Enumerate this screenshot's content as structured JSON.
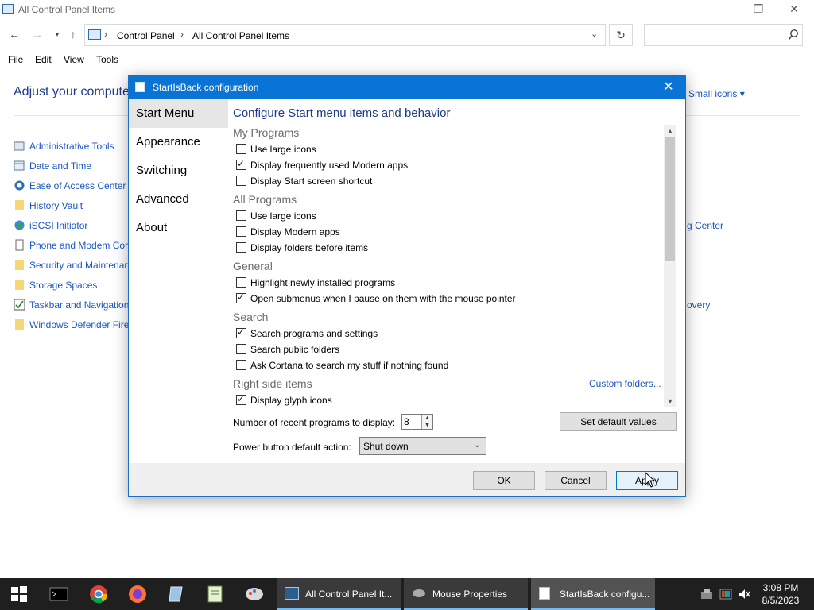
{
  "explorer": {
    "title": "All Control Panel Items",
    "breadcrumbs": [
      "Control Panel",
      "All Control Panel Items"
    ],
    "search_placeholder": "",
    "menu": [
      "File",
      "Edit",
      "View",
      "Tools"
    ],
    "heading": "Adjust your compute",
    "view_by": "Small icons ▾",
    "items": [
      {
        "label": "Administrative Tools",
        "icon": "admin-tools-icon"
      },
      {
        "label": "Date and Time",
        "icon": "date-time-icon"
      },
      {
        "label": "Ease of Access Center",
        "icon": "ease-access-icon"
      },
      {
        "label": "History Vault",
        "icon": "folder-icon"
      },
      {
        "label": "iSCSI Initiator",
        "icon": "iscsi-icon"
      },
      {
        "label": "Phone and Modem Cor",
        "icon": "phone-icon"
      },
      {
        "label": "Security and Maintenan",
        "icon": "folder-icon"
      },
      {
        "label": "Storage Spaces",
        "icon": "folder-icon"
      },
      {
        "label": "Taskbar and Navigation",
        "icon": "taskbar-icon"
      },
      {
        "label": "Windows Defender Firev",
        "icon": "folder-icon"
      }
    ],
    "right_items": [
      "g Center",
      "overy"
    ]
  },
  "dialog": {
    "title": "StartIsBack configuration",
    "nav": [
      "Start Menu",
      "Appearance",
      "Switching",
      "Advanced",
      "About"
    ],
    "active_nav": 0,
    "heading": "Configure Start menu items and behavior",
    "groups": [
      {
        "name": "My Programs",
        "options": [
          {
            "label": "Use large icons",
            "checked": false
          },
          {
            "label": "Display frequently used Modern apps",
            "checked": true
          },
          {
            "label": "Display Start screen shortcut",
            "checked": false
          }
        ]
      },
      {
        "name": "All Programs",
        "options": [
          {
            "label": "Use large icons",
            "checked": false
          },
          {
            "label": "Display Modern apps",
            "checked": false
          },
          {
            "label": "Display folders before items",
            "checked": false
          }
        ]
      },
      {
        "name": "General",
        "options": [
          {
            "label": "Highlight newly installed programs",
            "checked": false
          },
          {
            "label": "Open submenus when I pause on them with the mouse pointer",
            "checked": true
          }
        ]
      },
      {
        "name": "Search",
        "options": [
          {
            "label": "Search programs and settings",
            "checked": true
          },
          {
            "label": "Search public folders",
            "checked": false
          },
          {
            "label": "Ask Cortana to search my stuff if nothing found",
            "checked": false
          }
        ]
      },
      {
        "name": "Right side items",
        "options": [
          {
            "label": "Display glyph icons",
            "checked": true
          }
        ]
      }
    ],
    "custom_folders": "Custom folders...",
    "recent_label": "Number of recent programs to display:",
    "recent_value": "8",
    "set_default": "Set default values",
    "power_label": "Power button default action:",
    "power_value": "Shut down",
    "ok": "OK",
    "cancel": "Cancel",
    "apply": "Apply"
  },
  "taskbar": {
    "tasks": [
      {
        "label": "All Control Panel It...",
        "icon": "control-panel-icon"
      },
      {
        "label": "Mouse Properties",
        "icon": "mouse-icon"
      },
      {
        "label": "StartIsBack configu...",
        "icon": "startisback-icon"
      }
    ],
    "time": "3:08 PM",
    "date": "8/5/2023"
  },
  "colors": {
    "accent": "#0a74d6",
    "link": "#1a56c4",
    "taskbar": "#1f1f1f"
  }
}
